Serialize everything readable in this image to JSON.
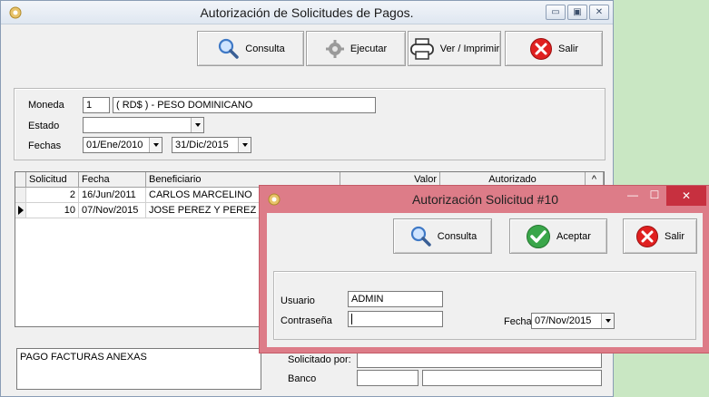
{
  "main_window": {
    "title": "Autorización de Solicitudes de Pagos.",
    "title_buttons": {
      "minimize": "▭",
      "maximize": "▣",
      "close": "✕"
    },
    "toolbar": {
      "consulta": "Consulta",
      "ejecutar": "Ejecutar",
      "ver_imprimir": "Ver / Imprimir",
      "salir": "Salir"
    },
    "filters": {
      "moneda_label": "Moneda",
      "moneda_code": "1",
      "moneda_name": "( RD$ ) - PESO DOMINICANO",
      "estado_label": "Estado",
      "estado_value": "",
      "fechas_label": "Fechas",
      "fecha_desde": "01/Ene/2010",
      "fecha_hasta": "31/Dic/2015"
    },
    "grid": {
      "columns": [
        "Solicitud",
        "Fecha",
        "Beneficiario",
        "Valor",
        "Autorizado"
      ],
      "rows": [
        {
          "solicitud": "2",
          "fecha": "16/Jun/2011",
          "beneficiario": "CARLOS MARCELINO"
        },
        {
          "solicitud": "10",
          "fecha": "07/Nov/2015",
          "beneficiario": "JOSE PEREZ Y PEREZ"
        }
      ],
      "scroll_up": "^"
    },
    "bottom": {
      "concepto": "PAGO FACTURAS ANEXAS",
      "solicitado_por_label": "Solicitado por:",
      "banco_label": "Banco"
    }
  },
  "dialog": {
    "title": "Autorización Solicitud #10",
    "title_buttons": {
      "minimize": "—",
      "maximize": "☐",
      "close": "✕"
    },
    "toolbar": {
      "consulta": "Consulta",
      "aceptar": "Aceptar",
      "salir": "Salir"
    },
    "form": {
      "usuario_label": "Usuario",
      "usuario_value": "ADMIN",
      "contrasena_label": "Contraseña",
      "contrasena_value": "",
      "fecha_label": "Fecha",
      "fecha_value": "07/Nov/2015"
    }
  },
  "colors": {
    "desktop": "#c9e7c3",
    "dialog_frame": "#dd7c88",
    "salir_red": "#e02020",
    "aceptar_green": "#3aa64a"
  },
  "icons": [
    "app-icon",
    "magnifier-icon",
    "gear-icon",
    "printer-icon",
    "close-x-icon",
    "checkmark-icon",
    "dropdown-arrow-icon",
    "row-pointer-icon"
  ]
}
